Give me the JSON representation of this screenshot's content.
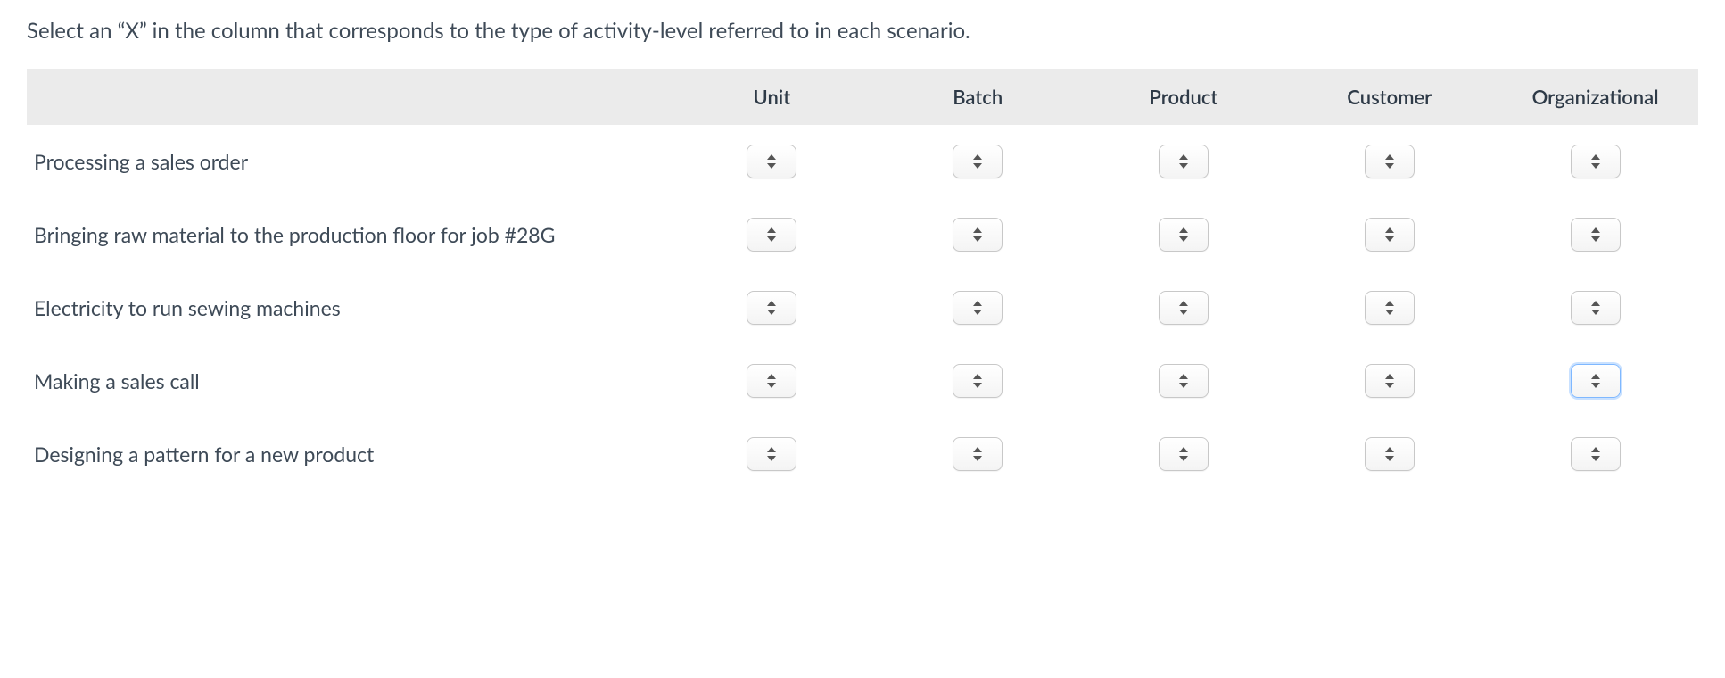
{
  "instruction": "Select an “X” in the column that corresponds to the type of activity-level referred to in each scenario.",
  "columns": [
    "Unit",
    "Batch",
    "Product",
    "Customer",
    "Organizational"
  ],
  "rows": [
    {
      "label": "Processing a sales order"
    },
    {
      "label": "Bringing raw material to the production floor for job #28G"
    },
    {
      "label": "Electricity to run sewing machines"
    },
    {
      "label": "Making a sales call"
    },
    {
      "label": "Designing a pattern for a new product"
    }
  ],
  "focused": {
    "row": 3,
    "col": 4
  }
}
